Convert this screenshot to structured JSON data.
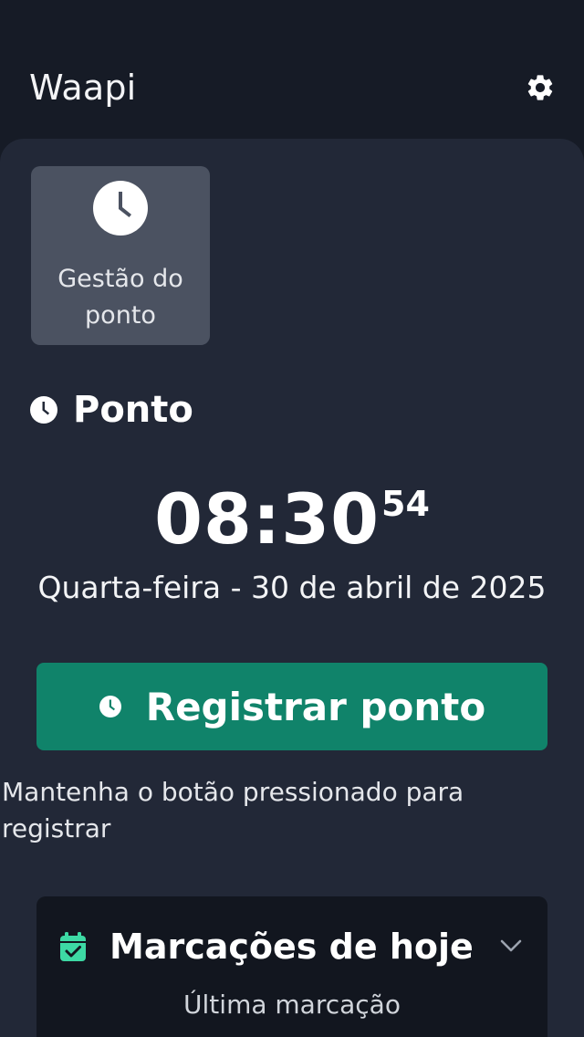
{
  "header": {
    "app_title": "Waapi",
    "settings_icon": "gear-icon"
  },
  "shortcuts": [
    {
      "label": "Gestão do ponto",
      "icon": "clock-icon"
    }
  ],
  "ponto": {
    "title": "Ponto",
    "icon": "clock-icon",
    "time_hm": "08:30",
    "time_seconds": "54",
    "date": "Quarta-feira - 30 de abril de 2025",
    "register_label": "Registrar ponto",
    "register_icon": "clock-icon",
    "hint": "Mantenha o botão pressionado para registrar"
  },
  "today_marks": {
    "title": "Marcações de hoje",
    "icon": "calendar-check-icon",
    "toggle_icon": "chevron-down-icon",
    "last_mark_label": "Última marcação"
  },
  "colors": {
    "background": "#161b26",
    "panel": "#222837",
    "tile": "#4b5261",
    "accent_green": "#10836a",
    "calendar_icon": "#3dd9a4"
  }
}
